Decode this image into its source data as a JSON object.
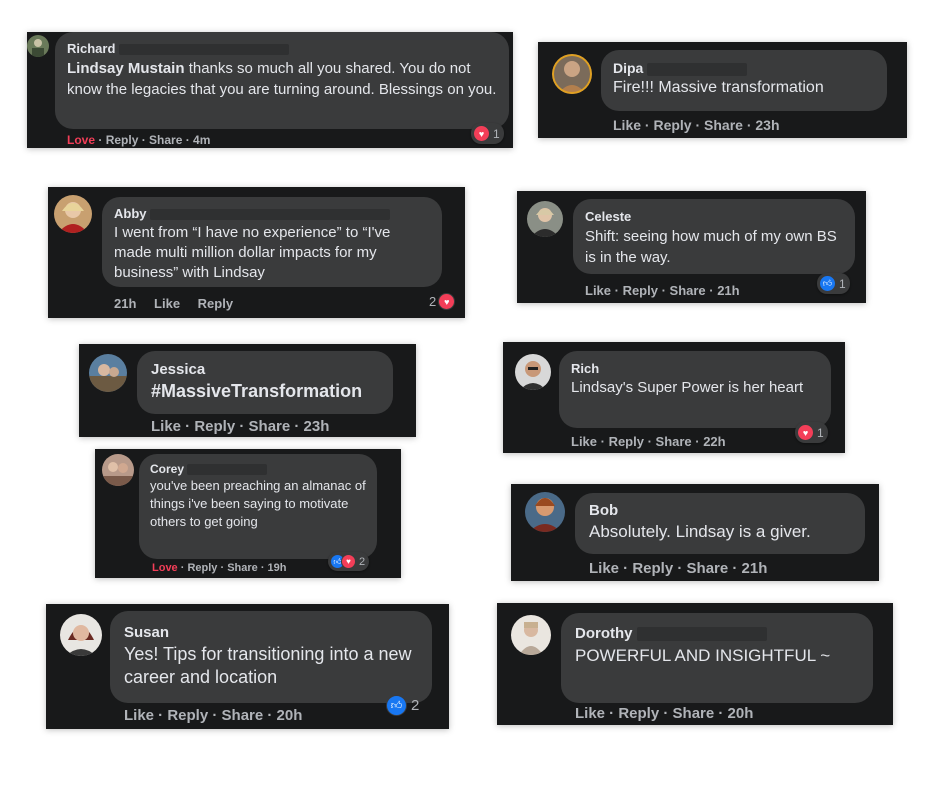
{
  "comments": [
    {
      "name": "Richard",
      "mention": "Lindsay Mustain",
      "text": " thanks so much all you shared. You do not know the legacies that you are turning around. Blessings on you.",
      "love": "Love",
      "actions": "Reply · Share · 4m",
      "react_count": "1"
    },
    {
      "name": "Dipa",
      "text": "Fire!!! Massive transformation",
      "actions": "Like · Reply · Share · 23h"
    },
    {
      "name": "Abby",
      "text": "I went from “I have no experience” to “I've made multi million dollar impacts for my business” with Lindsay",
      "time": "21h",
      "like": "Like",
      "reply": "Reply",
      "react_count": "2"
    },
    {
      "name": "Celeste",
      "text": "Shift: seeing how much of my own BS is in the way.",
      "actions": "Like · Reply · Share · 21h",
      "react_count": "1"
    },
    {
      "name": "Jessica",
      "text": "#MassiveTransformation",
      "actions": "Like · Reply · Share · 23h"
    },
    {
      "name": "Rich",
      "text": "Lindsay's Super Power is her heart",
      "actions": "Like · Reply · Share · 22h",
      "react_count": "1"
    },
    {
      "name": "Corey",
      "text": "you've been preaching an almanac of things i've been saying to motivate others to get going",
      "love": "Love",
      "actions": "· Reply · Share · 19h",
      "react_count": "2"
    },
    {
      "name": "Bob",
      "text": "Absolutely. Lindsay is a giver.",
      "actions": "Like · Reply · Share · 21h"
    },
    {
      "name": "Susan",
      "text": "Yes! Tips for transitioning into a new career and location",
      "actions": "Like · Reply · Share · 20h",
      "react_count": "2"
    },
    {
      "name": "Dorothy",
      "text": "POWERFUL AND INSIGHTFUL ~",
      "actions": "Like · Reply · Share · 20h"
    }
  ],
  "colors": {
    "card_bg": "#18191a",
    "bubble_bg": "#3a3b3c",
    "text": "#e4e6eb",
    "meta": "#b0b3b8",
    "love": "#f33e58",
    "like_blue": "#1877f2"
  }
}
